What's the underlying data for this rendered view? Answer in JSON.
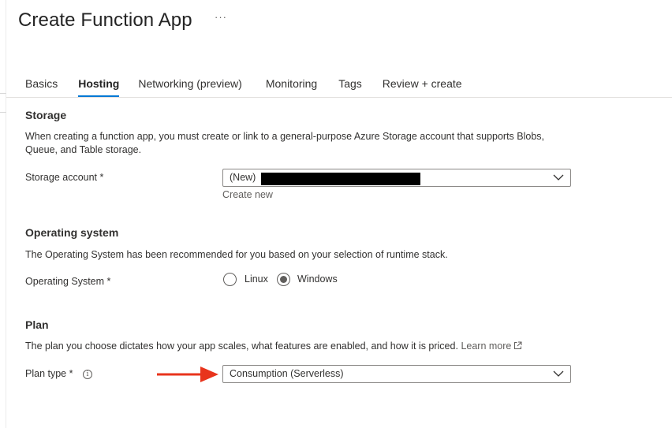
{
  "page": {
    "title": "Create Function App",
    "more_label": "···"
  },
  "tabs": [
    {
      "label": "Basics",
      "active": false
    },
    {
      "label": "Hosting",
      "active": true
    },
    {
      "label": "Networking (preview)",
      "active": false
    },
    {
      "label": "Monitoring",
      "active": false
    },
    {
      "label": "Tags",
      "active": false
    },
    {
      "label": "Review + create",
      "active": false
    }
  ],
  "storage": {
    "heading": "Storage",
    "description": "When creating a function app, you must create or link to a general-purpose Azure Storage account that supports Blobs, Queue, and Table storage.",
    "account_label": "Storage account *",
    "account_value": "(New)",
    "create_new": "Create new"
  },
  "os": {
    "heading": "Operating system",
    "description": "The Operating System has been recommended for you based on your selection of runtime stack.",
    "label": "Operating System *",
    "options": [
      {
        "label": "Linux",
        "checked": false
      },
      {
        "label": "Windows",
        "checked": true
      }
    ]
  },
  "plan": {
    "heading": "Plan",
    "description": "The plan you choose dictates how your app scales, what features are enabled, and how it is priced.",
    "learn_more": "Learn more",
    "type_label": "Plan type *",
    "info_glyph": "i",
    "type_value": "Consumption (Serverless)"
  },
  "colors": {
    "accent": "#0078d4",
    "arrow": "#e8341c"
  }
}
